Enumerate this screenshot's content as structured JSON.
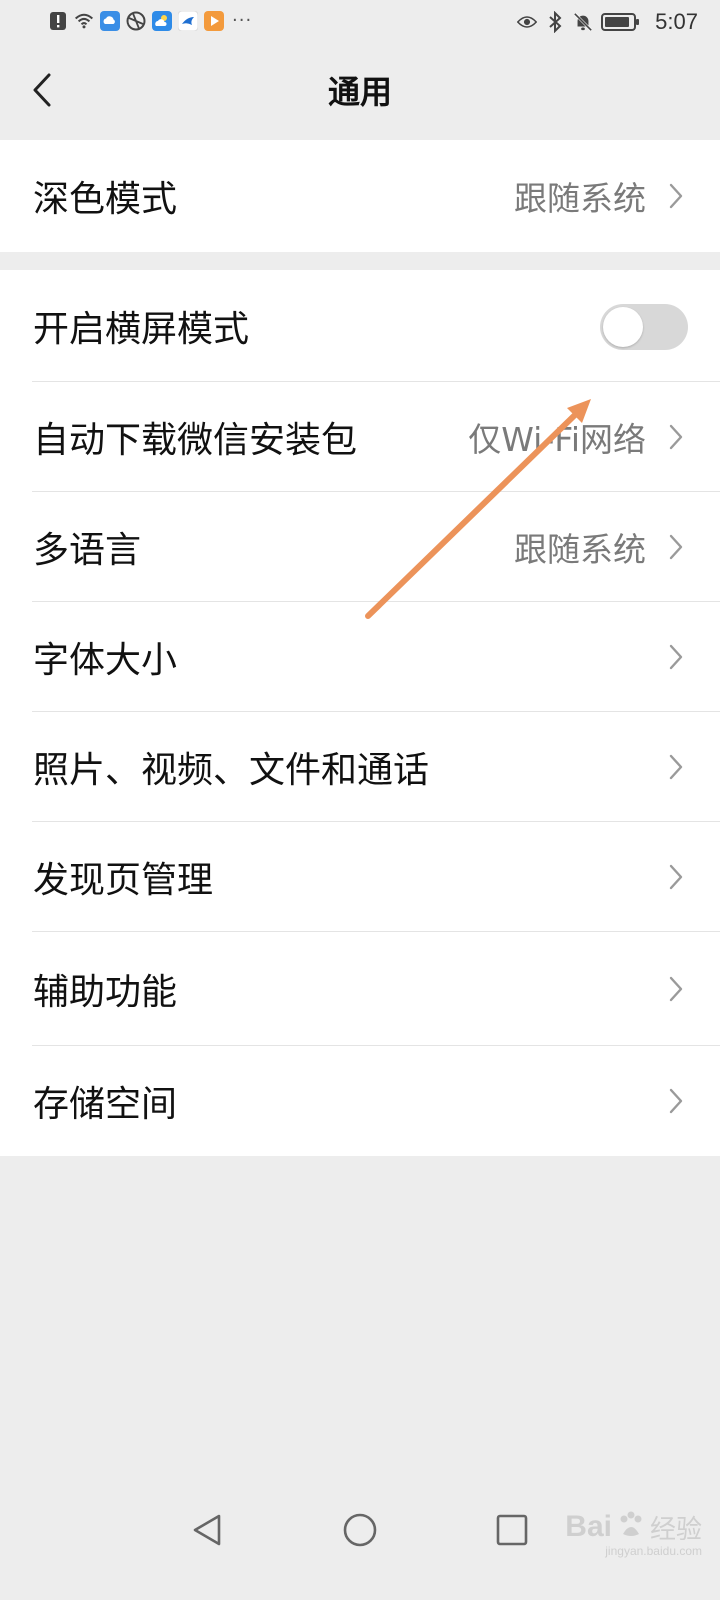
{
  "status_bar": {
    "time": "5:07",
    "left_icons": [
      "alert-icon",
      "wifi-icon",
      "cloud-icon",
      "globe-icon",
      "weather-icon",
      "bird-app-icon",
      "video-app-icon"
    ],
    "overflow": "···",
    "right_icons": [
      "eye-icon",
      "bluetooth-icon",
      "bell-muted-icon",
      "battery-icon"
    ]
  },
  "nav": {
    "title": "通用"
  },
  "settings": {
    "dark_mode": {
      "label": "深色模式",
      "value": "跟随系统"
    },
    "landscape": {
      "label": "开启横屏模式",
      "enabled": false
    },
    "auto_download": {
      "label": "自动下载微信安装包",
      "value": "仅Wi-Fi网络"
    },
    "language": {
      "label": "多语言",
      "value": "跟随系统"
    },
    "font_size": {
      "label": "字体大小"
    },
    "media": {
      "label": "照片、视频、文件和通话"
    },
    "discover": {
      "label": "发现页管理"
    },
    "accessibility": {
      "label": "辅助功能"
    },
    "storage": {
      "label": "存储空间"
    }
  },
  "watermark": {
    "brand": "Bai",
    "brand_cn": "经验",
    "sub": "jingyan.baidu.com"
  },
  "colors": {
    "annotation_arrow": "#ec935a",
    "toggle_off": "#d8d8d8",
    "page_bg": "#ededed"
  }
}
